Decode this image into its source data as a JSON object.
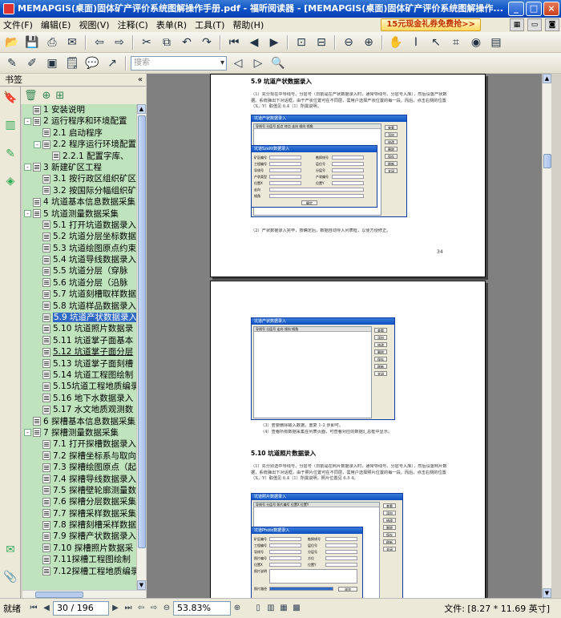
{
  "window": {
    "title": "MEMAPGIS(桌面)固体矿产评价系统图解操作手册.pdf - 福昕阅读器 - [MEMAPGIS(桌面)固体矿产评价系统图解操作...",
    "minimize": "_",
    "maximize": "□",
    "close": "×"
  },
  "menu": {
    "items": [
      "文件(F)",
      "编辑(E)",
      "视图(V)",
      "注释(C)",
      "表单(R)",
      "工具(T)",
      "帮助(H)"
    ],
    "promo": "15元现金礼券免费抢>>"
  },
  "toolbar2": {
    "search_placeholder": "搜索"
  },
  "sidebar": {
    "header": "书签",
    "collapse": "«",
    "bookmarks": [
      {
        "label": "1 安装说明",
        "level": 0,
        "toggle": ""
      },
      {
        "label": "2 运行程序和环境配置",
        "level": 0,
        "toggle": "-"
      },
      {
        "label": "2.1 启动程序",
        "level": 1,
        "toggle": ""
      },
      {
        "label": "2.2 程序运行环境配置",
        "level": 1,
        "toggle": "-"
      },
      {
        "label": "2.2.1 配置字库、",
        "level": 2,
        "toggle": ""
      },
      {
        "label": "3 新建矿区工程",
        "level": 0,
        "toggle": "-"
      },
      {
        "label": "3.1 按行政区组织矿区",
        "level": 1,
        "toggle": ""
      },
      {
        "label": "3.2 按国际分幅组织矿区",
        "level": 1,
        "toggle": ""
      },
      {
        "label": "4 坑道基本信息数据采集",
        "level": 0,
        "toggle": ""
      },
      {
        "label": "5 坑道测量数据采集",
        "level": 0,
        "toggle": "-"
      },
      {
        "label": "5.1 打开坑道数据录入",
        "level": 1,
        "toggle": ""
      },
      {
        "label": "5.2 坑道分层坐标数据",
        "level": 1,
        "toggle": ""
      },
      {
        "label": "5.3 坑道绘图原点约束",
        "level": 1,
        "toggle": ""
      },
      {
        "label": "5.4 坑道导线数据录入",
        "level": 1,
        "toggle": ""
      },
      {
        "label": "5.5 坑道分层（穿脉",
        "level": 1,
        "toggle": ""
      },
      {
        "label": "5.6 坑道分层（沿脉",
        "level": 1,
        "toggle": ""
      },
      {
        "label": "5.7 坑道刻槽取样数据",
        "level": 1,
        "toggle": ""
      },
      {
        "label": "5.8 坑道样品数据录入",
        "level": 1,
        "toggle": ""
      },
      {
        "label": "5.9 坑道产状数据录入",
        "level": 1,
        "toggle": "",
        "selected": true
      },
      {
        "label": "5.10 坑道照片数据录",
        "level": 1,
        "toggle": ""
      },
      {
        "label": "5.11 坑道掌子面基本",
        "level": 1,
        "toggle": ""
      },
      {
        "label": "5.12 坑道掌子面分层",
        "level": 1,
        "toggle": "",
        "underline": true
      },
      {
        "label": "5.13 坑道掌子面刻槽",
        "level": 1,
        "toggle": ""
      },
      {
        "label": "5.14 坑道工程图绘制",
        "level": 1,
        "toggle": ""
      },
      {
        "label": "5.15坑道工程地质编录",
        "level": 1,
        "toggle": ""
      },
      {
        "label": "5.16 地下水数据录入",
        "level": 1,
        "toggle": ""
      },
      {
        "label": "5.17 水文地质观测数",
        "level": 1,
        "toggle": ""
      },
      {
        "label": "6 探槽基本信息数据采集",
        "level": 0,
        "toggle": ""
      },
      {
        "label": "7 探槽测量数据采集",
        "level": 0,
        "toggle": "-"
      },
      {
        "label": "7.1 打开探槽数据录入",
        "level": 1,
        "toggle": ""
      },
      {
        "label": "7.2 探槽坐标系与取向",
        "level": 1,
        "toggle": ""
      },
      {
        "label": "7.3 探槽绘图原点（起",
        "level": 1,
        "toggle": ""
      },
      {
        "label": "7.4 探槽导线数据录入",
        "level": 1,
        "toggle": ""
      },
      {
        "label": "7.5 探槽壁轮廓测量数",
        "level": 1,
        "toggle": ""
      },
      {
        "label": "7.6 探槽分层数据采集",
        "level": 1,
        "toggle": ""
      },
      {
        "label": "7.7 探槽采样数据采集",
        "level": 1,
        "toggle": ""
      },
      {
        "label": "7.8 探槽刻槽采样数据",
        "level": 1,
        "toggle": ""
      },
      {
        "label": "7.9 探槽产状数据录入",
        "level": 1,
        "toggle": ""
      },
      {
        "label": "7.10 探槽照片数据采",
        "level": 1,
        "toggle": ""
      },
      {
        "label": "7.11探槽工程图绘制",
        "level": 1,
        "toggle": ""
      },
      {
        "label": "7.12探槽工程地质编录",
        "level": 1,
        "toggle": ""
      }
    ]
  },
  "document": {
    "page1": {
      "section": "5.9 坑道产状数据录入",
      "para1": "（1）充分现在中导线号、分层号（日前是在产状数据录入时，通常导线号、分层号入库），然后设置产状数据。系统弹出下对话框，由于产状位置可在不同层，需用户选择产状位置的每一段。而后，点击右侧的位置（X，Y）取值见 6.4（1）所属说明。",
      "dialog_outer_title": "坑道产状数据录入",
      "dialog_inner_title": "坑道Szeltt数据录入",
      "para2": "（2）产状数据录入完毕，按确定后，数据自动导入列表框，以便方便修正。",
      "page_number": "34"
    },
    "page2": {
      "dialog_title": "坑道产状数据录入",
      "note3": "（3）若要删除输入数据，重复 1-2 步即可。",
      "note4": "（4）查看所有数据采集在列表页面，可查看对应的数据汇总框中显示。",
      "section": "5.10 坑道照片数据录入",
      "para1": "（1）先分别选中导线号、分层号（日前是在照片数据录入时，通常导线号、分层号入库），然后设置照片数据，系统弹出下对话框，由于照片位置可在不同层，需用户选择照片位置的每一段。而后，点击右侧的位置（X，Y）取值见 6.4（1）所属说明，照片位置见 6.5 4。",
      "dialog_outer_title": "坑道照片数据录入",
      "dialog_inner_title": "坑道Photo数据录入"
    }
  },
  "status": {
    "ready": "就绪",
    "page_display": "30 / 196",
    "zoom": "53.83%",
    "doc_size": "文件: [8.27 * 11.69 英寸]"
  }
}
